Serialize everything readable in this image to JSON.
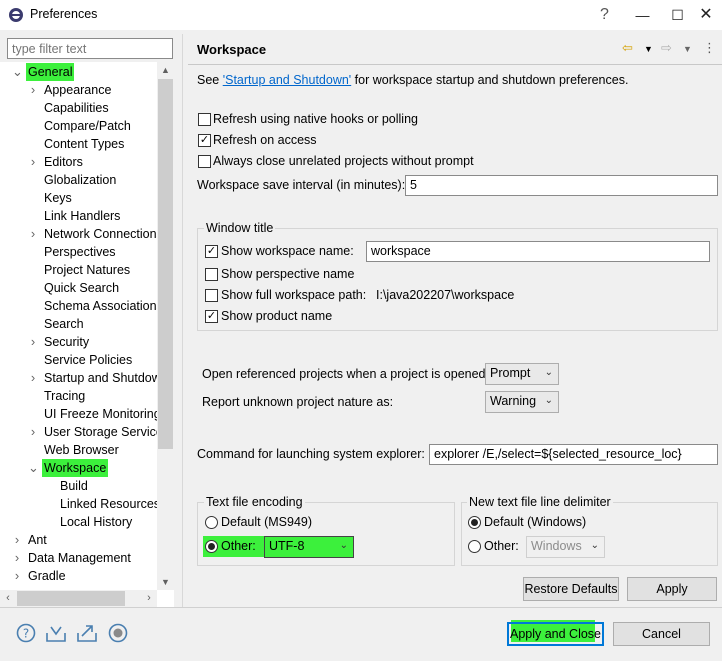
{
  "window": {
    "title": "Preferences",
    "help_icon": "?",
    "min_icon": "—",
    "max_icon": "☐",
    "close_icon": "✕"
  },
  "filter": {
    "placeholder": "type filter text"
  },
  "tree": [
    {
      "label": "General",
      "twisty": "v"
    },
    {
      "label": "Appearance",
      "twisty": ">"
    },
    {
      "label": "Capabilities",
      "twisty": ""
    },
    {
      "label": "Compare/Patch",
      "twisty": ""
    },
    {
      "label": "Content Types",
      "twisty": ""
    },
    {
      "label": "Editors",
      "twisty": ">"
    },
    {
      "label": "Globalization",
      "twisty": ""
    },
    {
      "label": "Keys",
      "twisty": ""
    },
    {
      "label": "Link Handlers",
      "twisty": ""
    },
    {
      "label": "Network Connections",
      "twisty": ">"
    },
    {
      "label": "Perspectives",
      "twisty": ""
    },
    {
      "label": "Project Natures",
      "twisty": ""
    },
    {
      "label": "Quick Search",
      "twisty": ""
    },
    {
      "label": "Schema Associations",
      "twisty": ""
    },
    {
      "label": "Search",
      "twisty": ""
    },
    {
      "label": "Security",
      "twisty": ">"
    },
    {
      "label": "Service Policies",
      "twisty": ""
    },
    {
      "label": "Startup and Shutdown",
      "twisty": ">"
    },
    {
      "label": "Tracing",
      "twisty": ""
    },
    {
      "label": "UI Freeze Monitoring",
      "twisty": ""
    },
    {
      "label": "User Storage Service",
      "twisty": ">"
    },
    {
      "label": "Web Browser",
      "twisty": ""
    },
    {
      "label": "Workspace",
      "twisty": "v"
    },
    {
      "label": "Build",
      "twisty": ""
    },
    {
      "label": "Linked Resources",
      "twisty": ""
    },
    {
      "label": "Local History",
      "twisty": ""
    },
    {
      "label": "Ant",
      "twisty": ">"
    },
    {
      "label": "Data Management",
      "twisty": ">"
    },
    {
      "label": "Gradle",
      "twisty": ">"
    }
  ],
  "page": {
    "heading": "Workspace",
    "see_prefix": "See ",
    "see_link": "'Startup and Shutdown'",
    "see_suffix": " for workspace startup and shutdown preferences.",
    "refresh_native": "Refresh using native hooks or polling",
    "refresh_access": "Refresh on access",
    "close_unrelated": "Always close unrelated projects without prompt",
    "save_interval_label": "Workspace save interval (in minutes):",
    "save_interval_value": "5",
    "window_title": {
      "group_label": "Window title",
      "show_ws_name": "Show workspace name:",
      "ws_name_value": "workspace",
      "show_perspective": "Show perspective name",
      "show_full_path": "Show full workspace path:",
      "full_path_value": "I:\\java202207\\workspace",
      "show_product": "Show product name"
    },
    "open_ref_label": "Open referenced projects when a project is opened:",
    "open_ref_value": "Prompt",
    "report_unknown_label": "Report unknown project nature as:",
    "report_unknown_value": "Warning",
    "cmd_label": "Command for launching system explorer:",
    "cmd_value": "explorer /E,/select=${selected_resource_loc}",
    "encoding": {
      "group_label": "Text file encoding",
      "default_label": "Default (MS949)",
      "other_label": "Other:",
      "other_value": "UTF-8"
    },
    "delimiter": {
      "group_label": "New text file line delimiter",
      "default_label": "Default (Windows)",
      "other_label": "Other:",
      "other_value": "Windows"
    },
    "restore_defaults": "Restore Defaults",
    "apply": "Apply"
  },
  "footer": {
    "apply_close": "Apply and Close",
    "cancel": "Cancel"
  },
  "colors": {
    "highlight": "#3cf03c",
    "link": "#0066cc",
    "default_button_border": "#0078d7"
  }
}
